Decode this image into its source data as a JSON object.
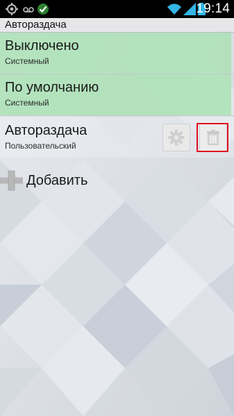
{
  "status_bar": {
    "time": "19:14",
    "icons": [
      "gps-icon",
      "voicemail-icon",
      "check-icon",
      "wifi-icon",
      "signal-icon",
      "battery-icon"
    ]
  },
  "title_bar": {
    "title": "Автораздача"
  },
  "list": [
    {
      "title": "Выключено",
      "subtitle": "Системный",
      "selected": true
    },
    {
      "title": "По умолчанию",
      "subtitle": "Системный",
      "selected": true
    },
    {
      "title": "Автораздача",
      "subtitle": "Пользовательский",
      "selected": false
    }
  ],
  "actions": {
    "settings_icon": "gear-icon",
    "delete_icon": "trash-icon"
  },
  "add": {
    "label": "Добавить",
    "icon": "plus-icon"
  },
  "colors": {
    "status_bar_bg": "#000000",
    "time_color": "#ffffff",
    "selected_row_bg": "#a8e2b2",
    "highlight_border": "#e0101e",
    "status_icon_accent": "#33b5e5",
    "check_circle": "#2e7d32"
  }
}
